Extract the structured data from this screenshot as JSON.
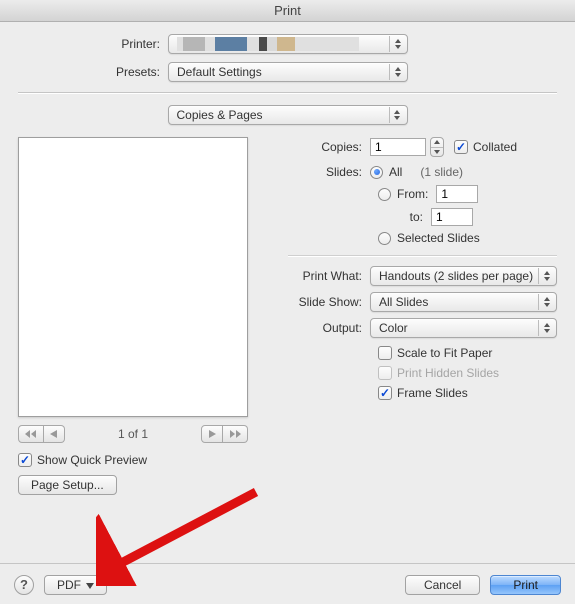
{
  "window": {
    "title": "Print"
  },
  "top": {
    "printer_label": "Printer:",
    "presets_label": "Presets:",
    "presets_value": "Default Settings",
    "section_value": "Copies & Pages"
  },
  "preview": {
    "page_indicator": "1 of 1",
    "show_quick_preview": "Show Quick Preview",
    "show_quick_preview_checked": true,
    "page_setup": "Page Setup..."
  },
  "settings": {
    "copies_label": "Copies:",
    "copies_value": "1",
    "collated_label": "Collated",
    "collated_checked": true,
    "slides_label": "Slides:",
    "all_label": "All",
    "all_hint": "(1 slide)",
    "from_label": "From:",
    "from_value": "1",
    "to_label": "to:",
    "to_value": "1",
    "selected_label": "Selected Slides",
    "print_what_label": "Print What:",
    "print_what_value": "Handouts (2 slides per page)",
    "slide_show_label": "Slide Show:",
    "slide_show_value": "All Slides",
    "output_label": "Output:",
    "output_value": "Color",
    "scale_label": "Scale to Fit Paper",
    "hidden_label": "Print Hidden Slides",
    "frame_label": "Frame Slides",
    "frame_checked": true
  },
  "footer": {
    "pdf": "PDF",
    "cancel": "Cancel",
    "print": "Print"
  }
}
